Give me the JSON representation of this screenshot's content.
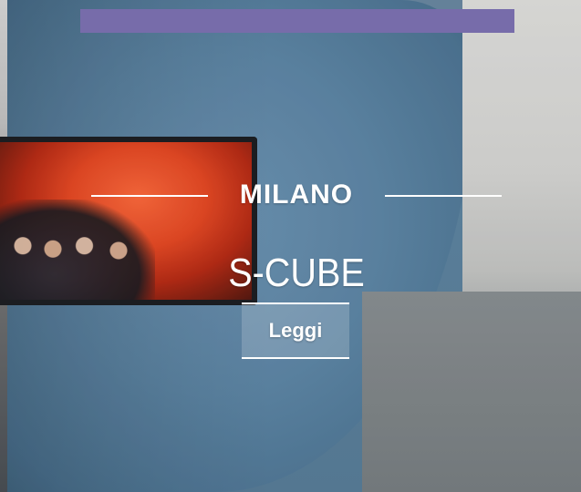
{
  "card": {
    "city": "MILANO",
    "title": "S-CUBE",
    "cta_label": "Leggi"
  },
  "colors": {
    "top_bar": "#7f73b5",
    "text": "#ffffff"
  }
}
